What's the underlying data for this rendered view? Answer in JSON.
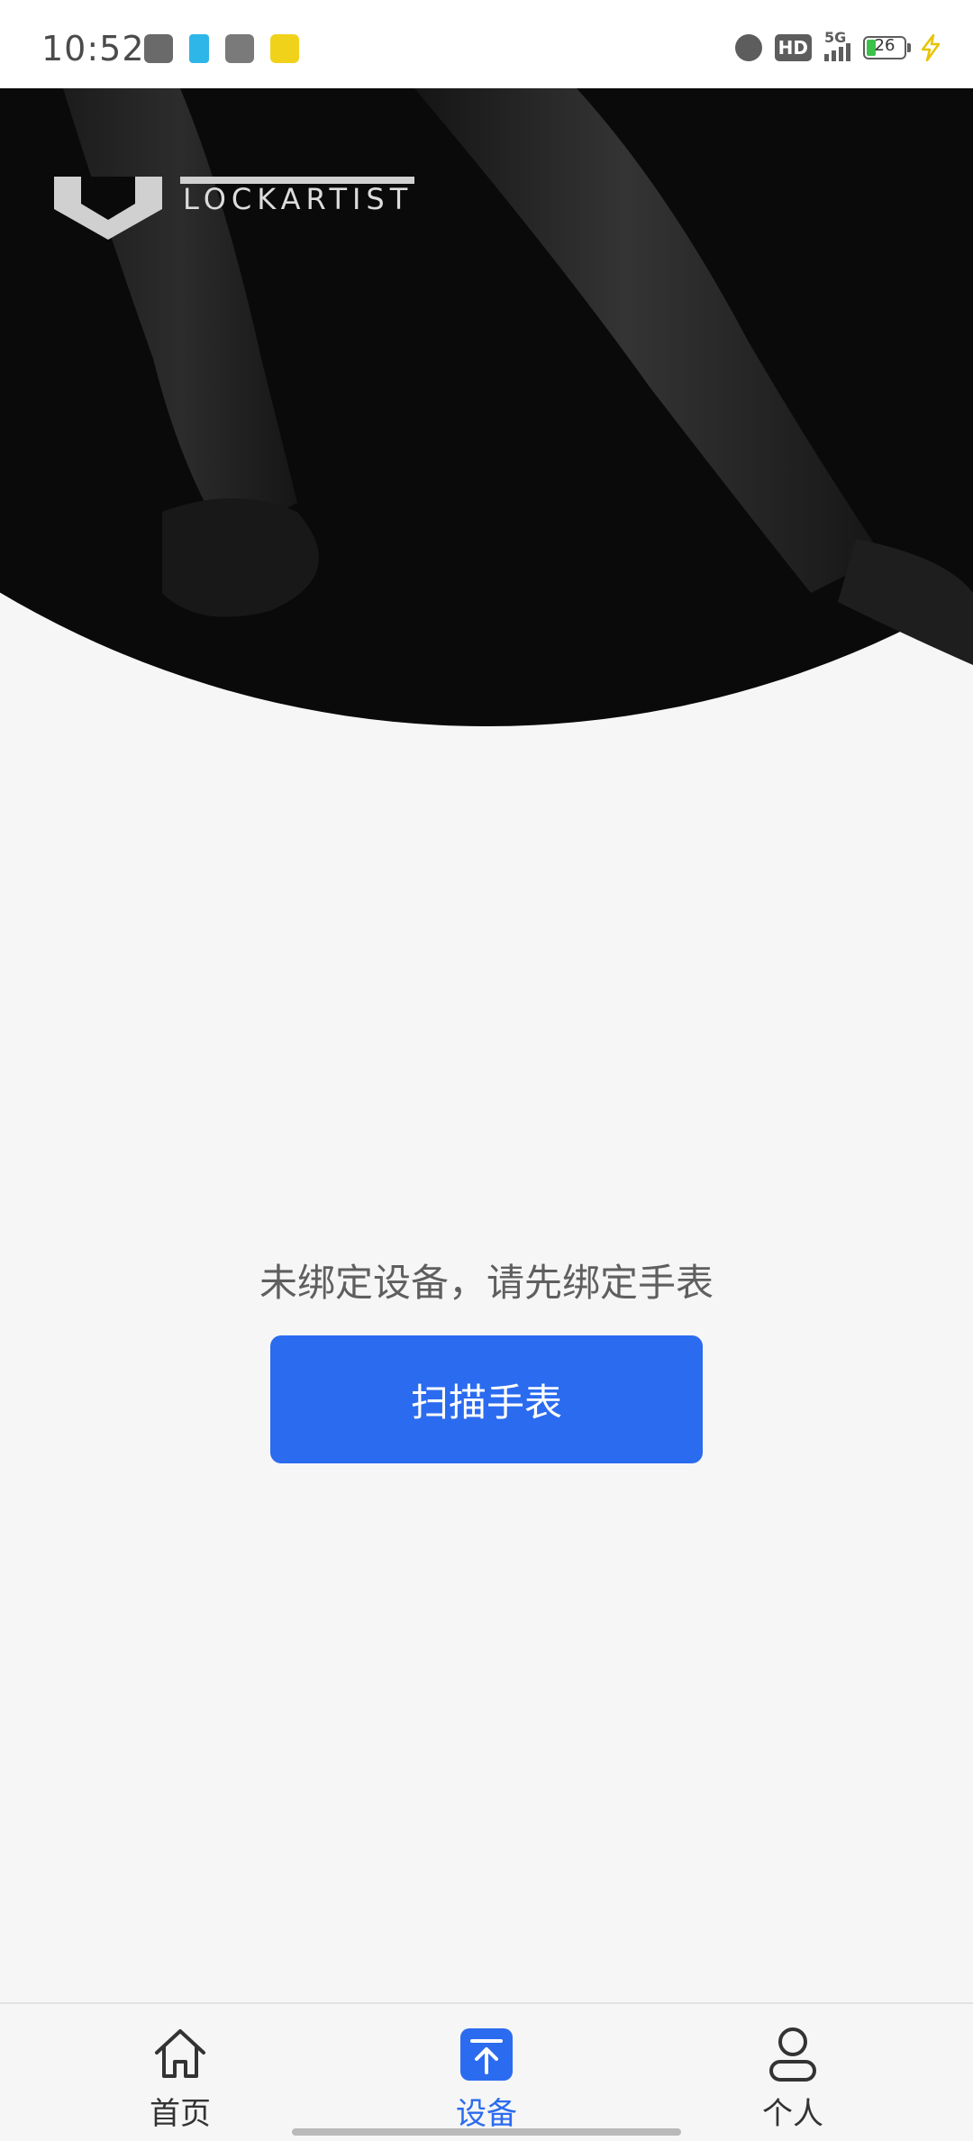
{
  "status_bar": {
    "time": "10:52",
    "left_icons": [
      "app-notification-icon",
      "app-notification-icon",
      "app-notification-icon",
      "app-notification-icon"
    ],
    "right_icons": [
      "alarm-icon",
      "hd-icon",
      "5g-signal-icon",
      "battery-icon",
      "charging-icon"
    ],
    "hd_label": "HD",
    "network_label": "5G",
    "battery_level": "26"
  },
  "hero": {
    "brand_name": "LOCKARTIST"
  },
  "main": {
    "empty_message": "未绑定设备，请先绑定手表",
    "scan_button_label": "扫描手表",
    "accent_color": "#2b6bef"
  },
  "bottom_nav": {
    "items": [
      {
        "label": "首页",
        "icon": "home-icon",
        "active": false
      },
      {
        "label": "设备",
        "icon": "device-upload-icon",
        "active": true
      },
      {
        "label": "个人",
        "icon": "person-icon",
        "active": false
      }
    ]
  }
}
